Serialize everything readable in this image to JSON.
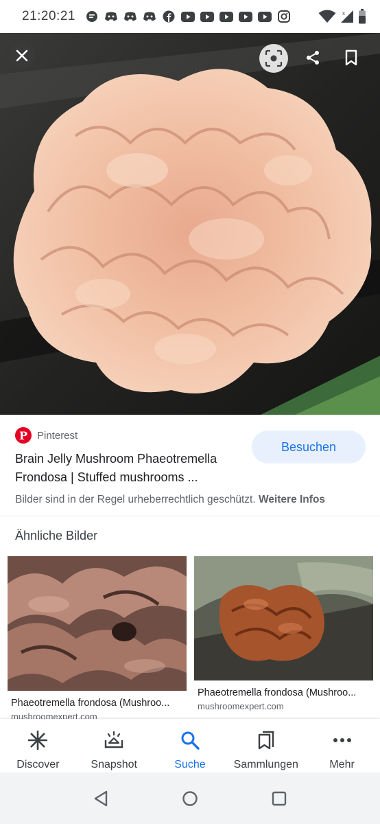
{
  "status_bar": {
    "time": "21:20:21",
    "notification_icons": [
      "chat-icon",
      "discord-icon",
      "discord-icon",
      "discord-icon",
      "facebook-icon",
      "youtube-icon",
      "youtube-icon",
      "youtube-icon",
      "youtube-icon",
      "youtube-icon",
      "instagram-icon"
    ],
    "signal_icons": [
      "wifi-icon",
      "cell-signal-icon",
      "battery-icon"
    ]
  },
  "hero": {
    "buttons": [
      "close-icon",
      "lens-icon",
      "share-icon",
      "bookmark-icon"
    ]
  },
  "result": {
    "source_name": "Pinterest",
    "title": "Brain Jelly Mushroom Phaeotremella Frondosa | Stuffed mushrooms ...",
    "visit_label": "Besuchen",
    "copyright_text": "Bilder sind in der Regel urheberrechtlich geschützt.",
    "more_info_label": "Weitere Infos"
  },
  "similar": {
    "heading": "Ähnliche Bilder",
    "items": [
      {
        "title": "Phaeotremella frondosa (Mushroo...",
        "source": "mushroomexpert.com"
      },
      {
        "title": "Phaeotremella frondosa (Mushroo...",
        "source": "mushroomexpert.com"
      }
    ]
  },
  "bottom_nav": {
    "items": [
      {
        "label": "Discover",
        "icon": "asterisk-icon"
      },
      {
        "label": "Snapshot",
        "icon": "snapshot-icon"
      },
      {
        "label": "Suche",
        "icon": "search-icon",
        "active": true
      },
      {
        "label": "Sammlungen",
        "icon": "collections-icon"
      },
      {
        "label": "Mehr",
        "icon": "more-dots-icon"
      }
    ]
  },
  "colors": {
    "accent": "#1a73e8",
    "visit_button_bg": "#e8f0fe",
    "pinterest_red": "#e60023"
  }
}
